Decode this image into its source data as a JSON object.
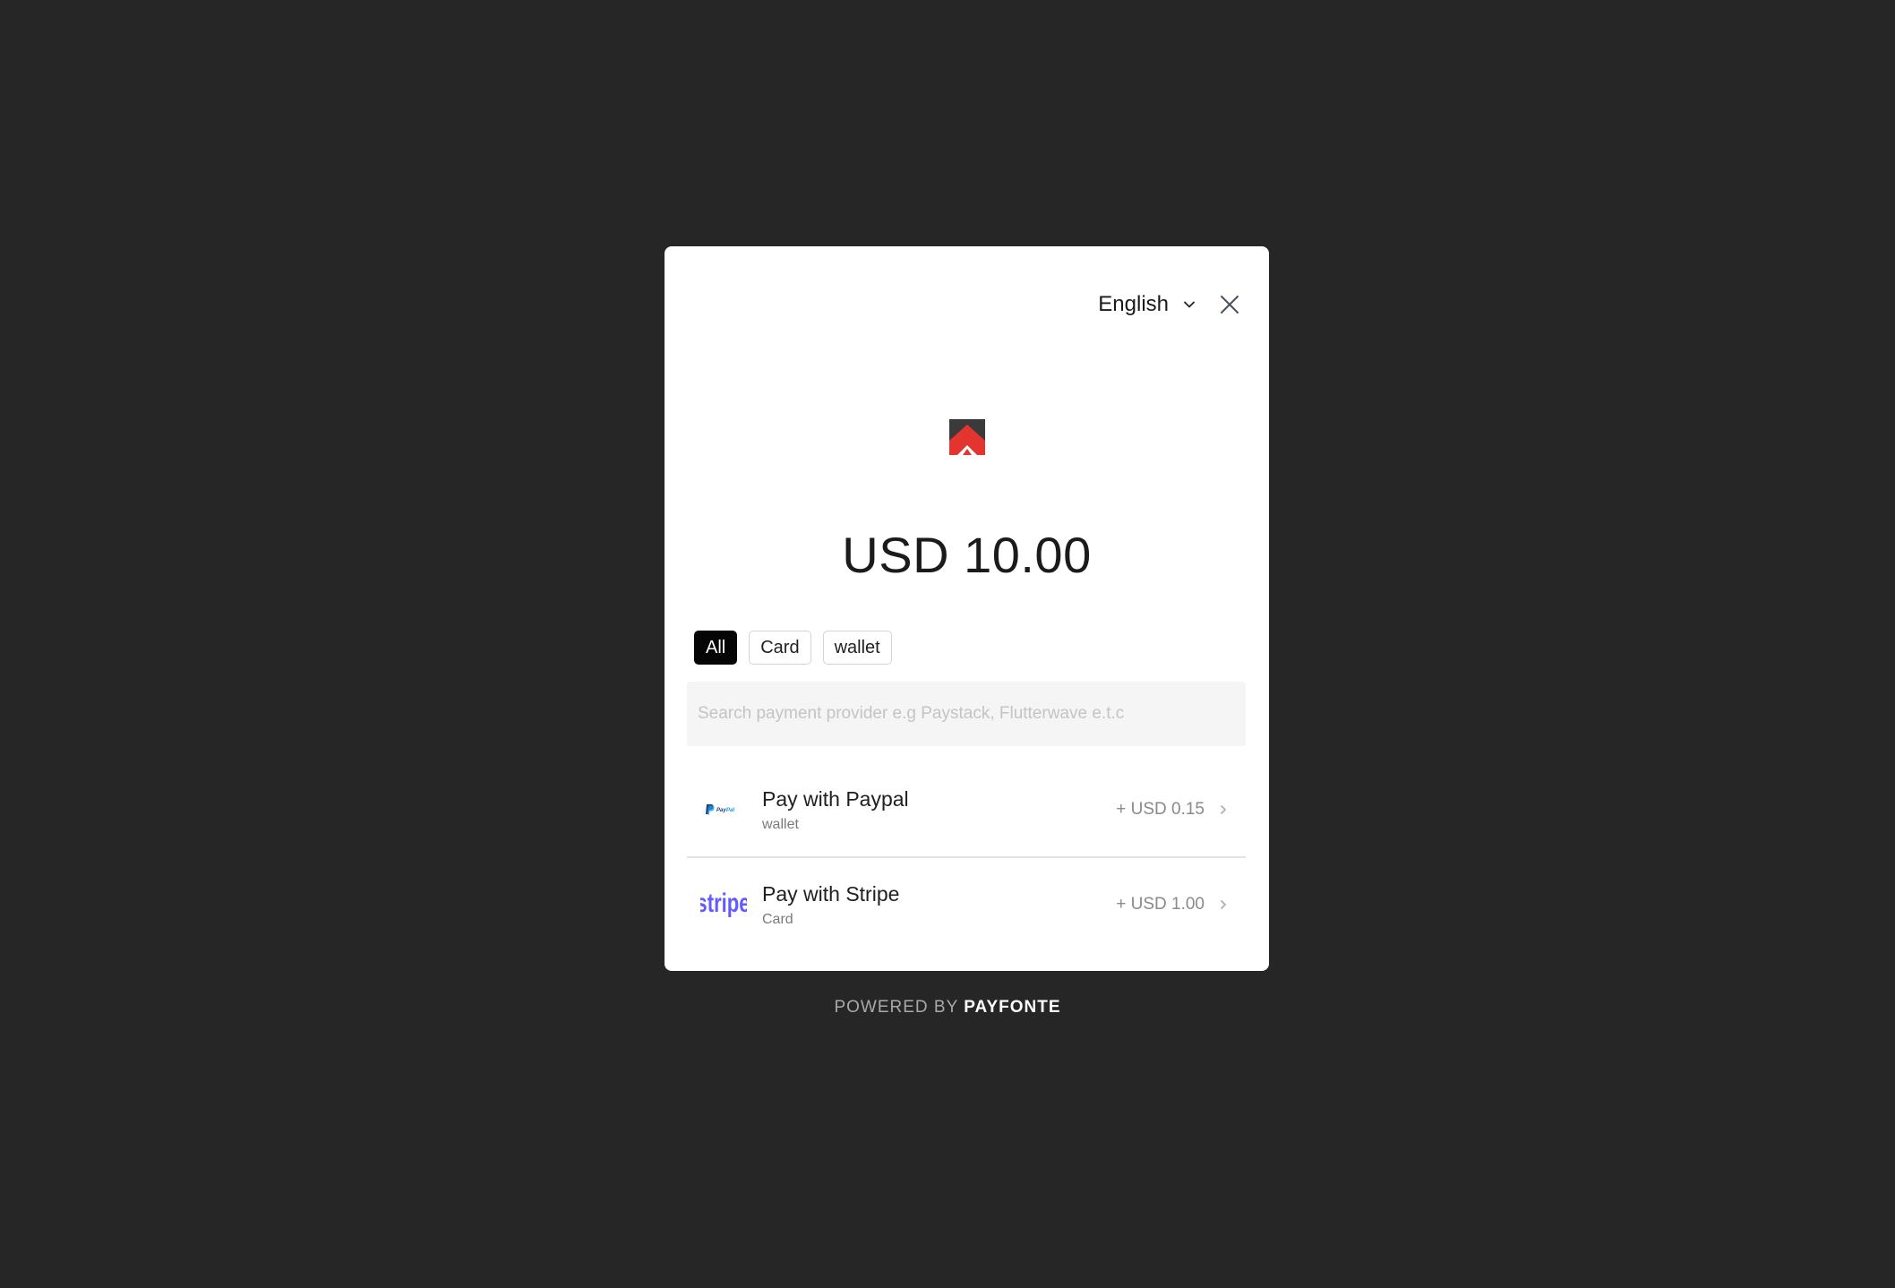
{
  "header": {
    "language": "English"
  },
  "payment": {
    "amount": "USD 10.00"
  },
  "filters": [
    {
      "label": "All",
      "active": true
    },
    {
      "label": "Card",
      "active": false
    },
    {
      "label": "wallet",
      "active": false
    }
  ],
  "search": {
    "placeholder": "Search payment provider e.g Paystack, Flutterwave e.t.c"
  },
  "providers": [
    {
      "title": "Pay with Paypal",
      "type": "wallet",
      "fee": "+ USD 0.15",
      "logo": "paypal-logo"
    },
    {
      "title": "Pay with Stripe",
      "type": "Card",
      "fee": "+ USD 1.00",
      "logo": "stripe-logo"
    }
  ],
  "footer": {
    "prefix": "POWERED BY",
    "brand": "PAYFONTE"
  },
  "colors": {
    "backdrop": "#262626",
    "logo_red": "#e3342f",
    "logo_dark": "#3a3a3a",
    "stripe": "#635bff",
    "paypal_dark": "#253b80",
    "paypal_light": "#179bd7"
  }
}
